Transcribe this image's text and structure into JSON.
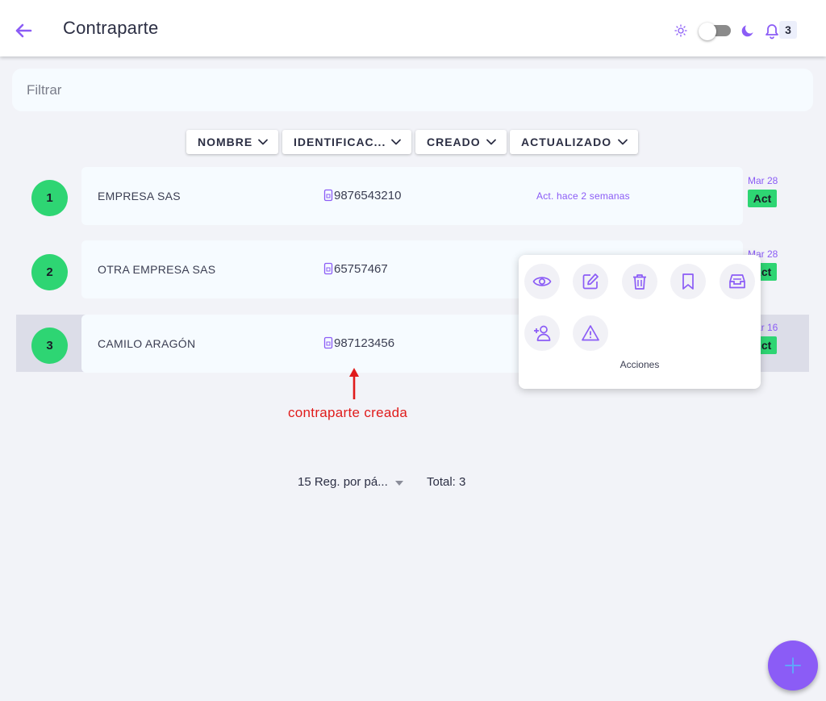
{
  "header": {
    "title": "Contraparte",
    "notifications_count": "3"
  },
  "filter": {
    "placeholder": "Filtrar"
  },
  "sort_buttons": [
    {
      "label": "NOMBRE"
    },
    {
      "label": "IDENTIFICAC..."
    },
    {
      "label": "CREADO"
    },
    {
      "label": "ACTUALIZADO"
    }
  ],
  "rows": [
    {
      "index": "1",
      "name": "EMPRESA SAS",
      "id": "9876543210",
      "updated": "Act. hace 2 semanas",
      "date": "Mar 28",
      "status": "Act"
    },
    {
      "index": "2",
      "name": "OTRA EMPRESA SAS",
      "id": "65757467",
      "date": "Mar 28",
      "status": "Act"
    },
    {
      "index": "3",
      "name": "CAMILO ARAGÓN",
      "id": "987123456",
      "date": "Mar 16",
      "status": "Act"
    }
  ],
  "actions_panel": {
    "label": "Acciones",
    "icons": [
      "eye-icon",
      "edit-icon",
      "trash-icon",
      "bookmark-icon",
      "archive-icon",
      "add-user-icon",
      "warning-icon"
    ]
  },
  "annotation": {
    "text": "contraparte creada"
  },
  "pagination": {
    "per_page": "15 Reg. por pá...",
    "total": "Total: 3"
  },
  "colors": {
    "accent": "#8b5cf6",
    "status_green": "#2ed573",
    "annotation_red": "#e01b1b"
  }
}
